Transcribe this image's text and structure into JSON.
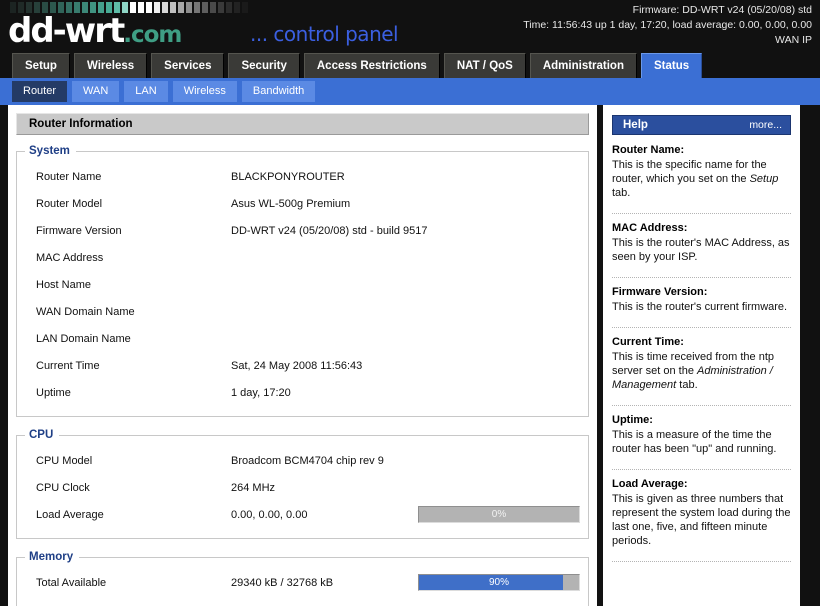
{
  "brand": {
    "logo_main": "dd-wrt",
    "logo_suffix": ".com",
    "control_panel": "... control panel"
  },
  "header": {
    "firmware_line": "Firmware: DD-WRT v24 (05/20/08) std",
    "time_line": "Time: 11:56:43 up 1 day, 17:20, load average: 0.00, 0.00, 0.00",
    "wan_ip_line": "WAN IP"
  },
  "main_tabs": [
    {
      "label": "Setup",
      "active": false
    },
    {
      "label": "Wireless",
      "active": false
    },
    {
      "label": "Services",
      "active": false
    },
    {
      "label": "Security",
      "active": false
    },
    {
      "label": "Access Restrictions",
      "active": false
    },
    {
      "label": "NAT / QoS",
      "active": false
    },
    {
      "label": "Administration",
      "active": false
    },
    {
      "label": "Status",
      "active": true
    }
  ],
  "sub_tabs": [
    {
      "label": "Router",
      "active": true
    },
    {
      "label": "WAN",
      "active": false
    },
    {
      "label": "LAN",
      "active": false
    },
    {
      "label": "Wireless",
      "active": false
    },
    {
      "label": "Bandwidth",
      "active": false
    }
  ],
  "panel": {
    "title": "Router Information"
  },
  "sections": {
    "system": {
      "legend": "System",
      "rows": [
        {
          "label": "Router Name",
          "value": "BLACKPONYROUTER"
        },
        {
          "label": "Router Model",
          "value": "Asus WL-500g Premium"
        },
        {
          "label": "Firmware Version",
          "value": "DD-WRT v24 (05/20/08) std - build 9517"
        },
        {
          "label": "MAC Address",
          "value": ""
        },
        {
          "label": "Host Name",
          "value": ""
        },
        {
          "label": "WAN Domain Name",
          "value": ""
        },
        {
          "label": "LAN Domain Name",
          "value": ""
        },
        {
          "label": "Current Time",
          "value": "Sat, 24 May 2008 11:56:43"
        },
        {
          "label": "Uptime",
          "value": "1 day, 17:20"
        }
      ]
    },
    "cpu": {
      "legend": "CPU",
      "rows": [
        {
          "label": "CPU Model",
          "value": "Broadcom BCM4704 chip rev 9"
        },
        {
          "label": "CPU Clock",
          "value": "264 MHz"
        }
      ],
      "load": {
        "label": "Load Average",
        "value": "0.00, 0.00, 0.00",
        "bar_label": "0%",
        "bar_percent": 0
      }
    },
    "memory": {
      "legend": "Memory",
      "total": {
        "label": "Total Available",
        "value": "29340 kB / 32768 kB",
        "bar_label": "90%",
        "bar_percent": 90
      }
    }
  },
  "help": {
    "title": "Help",
    "more": "more...",
    "items": [
      {
        "heading": "Router Name:",
        "text_before": "This is the specific name for the router, which you set on the ",
        "emphasis": "Setup",
        "text_after": " tab."
      },
      {
        "heading": "MAC Address:",
        "text_before": "This is the router's MAC Address, as seen by your ISP.",
        "emphasis": "",
        "text_after": ""
      },
      {
        "heading": "Firmware Version:",
        "text_before": "This is the router's current firmware.",
        "emphasis": "",
        "text_after": ""
      },
      {
        "heading": "Current Time:",
        "text_before": "This is time received from the ntp server set on the ",
        "emphasis": "Administration / Management",
        "text_after": " tab."
      },
      {
        "heading": "Uptime:",
        "text_before": "This is a measure of the time the router has been \"up\" and running.",
        "emphasis": "",
        "text_after": ""
      },
      {
        "heading": "Load Average:",
        "text_before": "This is given as three numbers that represent the system load during the last one, five, and fifteen minute periods.",
        "emphasis": "",
        "text_after": ""
      }
    ]
  },
  "colors": {
    "accent_blue": "#3b6fd4",
    "help_header": "#2b4f9e",
    "bar_fill": "#3f6fc8",
    "bar_track": "#b3b3b3",
    "legend_text": "#1f3f86",
    "logo_teal": "#3f9e84",
    "background": "#111111"
  }
}
